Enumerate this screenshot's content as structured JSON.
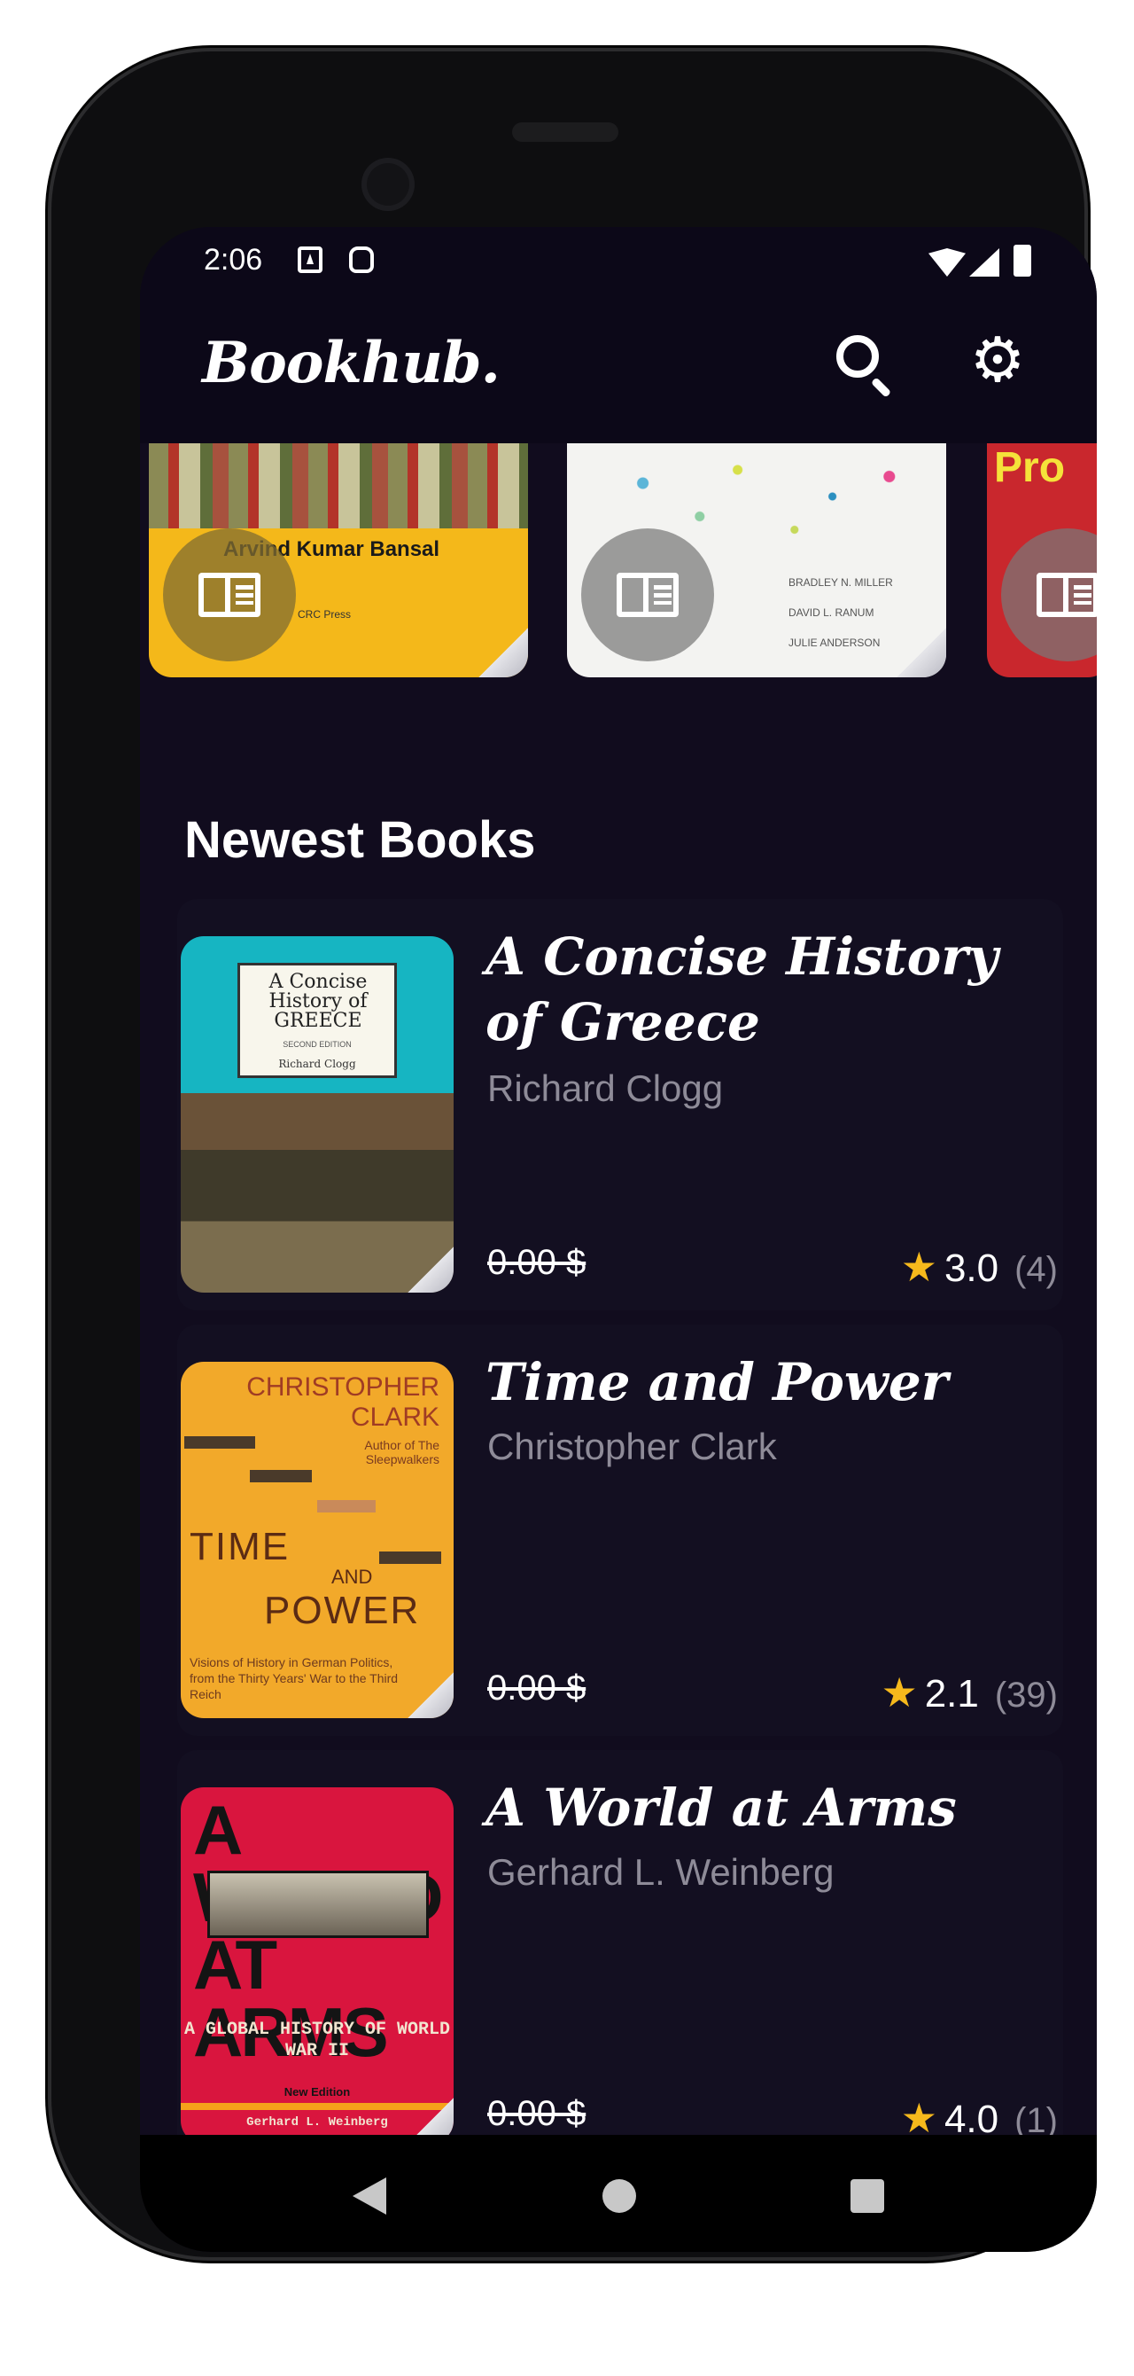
{
  "status_bar": {
    "time": "2:06"
  },
  "app_bar": {
    "logo": "Bookhub."
  },
  "colors": {
    "background": "#110c1e",
    "app_bar": "#0c0818",
    "star": "#f6b91c",
    "muted_text": "#8e8b98"
  },
  "icons": {
    "search": "search-icon",
    "settings": "gear-icon",
    "read": "book-open-icon",
    "star": "star-icon",
    "back": "nav-back-icon",
    "home": "nav-home-icon",
    "recents": "nav-recents-icon"
  },
  "featured": [
    {
      "cover_author": "Arvind Kumar Bansal",
      "cover_publisher": "CRC Press"
    },
    {
      "cover_names": [
        "BRADLEY N. MILLER",
        "DAVID L. RANUM",
        "JULIE ANDERSON"
      ]
    },
    {
      "cover_title": "Pro"
    }
  ],
  "newest": {
    "section_title": "Newest Books",
    "books": [
      {
        "title": "A Concise History of Greece",
        "author": "Richard Clogg",
        "price": "0.00 $",
        "rating": "3.0",
        "rating_count": "(4)",
        "cover": {
          "title": "A Concise History of GREECE",
          "edition": "SECOND EDITION",
          "author": "Richard Clogg"
        }
      },
      {
        "title": "Time and Power",
        "author": "Christopher Clark",
        "price": "0.00 $",
        "rating": "2.1",
        "rating_count": "(39)",
        "cover": {
          "author_line1": "CHRISTOPHER",
          "author_line2": "CLARK",
          "note": "Author of The Sleepwalkers",
          "title_time": "TIME",
          "title_and": "AND",
          "title_power": "POWER",
          "subtitle": "Visions of History in German Politics, from the Thirty Years' War to the Third Reich"
        }
      },
      {
        "title": "A World at Arms",
        "author": "Gerhard L. Weinberg",
        "price": "0.00 $",
        "rating": "4.0",
        "rating_count": "(1)",
        "cover": {
          "title": "A WORLD AT ARMS",
          "subtitle": "A GLOBAL HISTORY OF WORLD WAR II",
          "edition": "New Edition",
          "author": "Gerhard L. Weinberg"
        }
      }
    ]
  }
}
